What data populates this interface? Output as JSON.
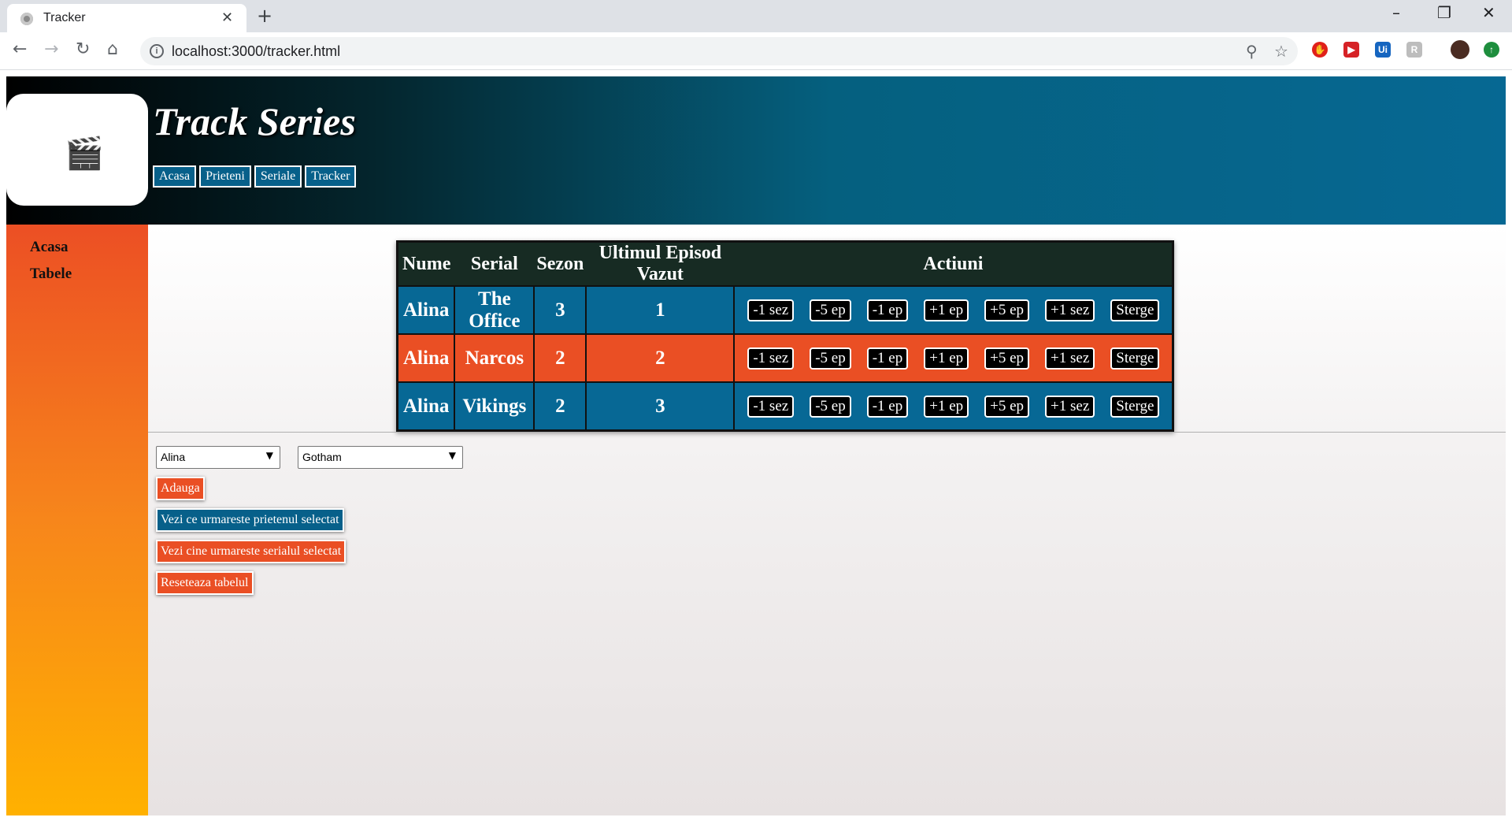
{
  "browser": {
    "tab_title": "Tracker",
    "url": "localhost:3000/tracker.html"
  },
  "header": {
    "title": "Track Series",
    "nav": [
      "Acasa",
      "Prieteni",
      "Seriale",
      "Tracker"
    ]
  },
  "sidebar": {
    "items": [
      "Acasa",
      "Tabele"
    ]
  },
  "table": {
    "headers": [
      "Nume",
      "Serial",
      "Sezon",
      "Ultimul Episod Vazut",
      "Actiuni"
    ],
    "actions": [
      "-1 sez",
      "-5 ep",
      "-1 ep",
      "+1 ep",
      "+5 ep",
      "+1 sez",
      "Sterge"
    ],
    "rows": [
      {
        "nume": "Alina",
        "serial": "The Office",
        "sezon": "3",
        "episod": "1",
        "color": "#076895"
      },
      {
        "nume": "Alina",
        "serial": "Narcos",
        "sezon": "2",
        "episod": "2",
        "color": "#ea4f24"
      },
      {
        "nume": "Alina",
        "serial": "Vikings",
        "sezon": "2",
        "episod": "3",
        "color": "#076895"
      }
    ]
  },
  "controls": {
    "friend_select": "Alina",
    "series_select": "Gotham",
    "add_button": "Adauga",
    "friend_watch_button": "Vezi ce urmareste prietenul selectat",
    "series_watch_button": "Vezi cine urmareste serialul selectat",
    "reset_button": "Reseteaza tabelul"
  },
  "colors": {
    "accent_blue": "#07608a",
    "accent_orange": "#ea4f24"
  }
}
